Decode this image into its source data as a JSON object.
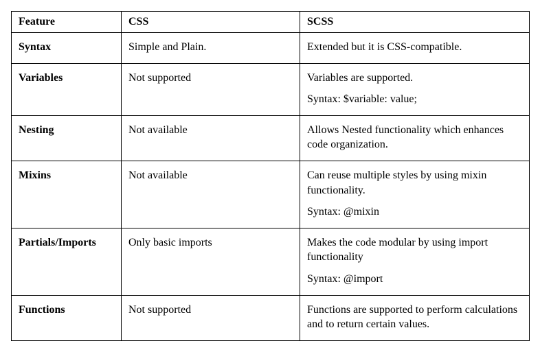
{
  "table": {
    "headers": [
      "Feature",
      "CSS",
      "SCSS"
    ],
    "rows": [
      {
        "feature": "Syntax",
        "css": [
          "Simple and Plain."
        ],
        "scss": [
          "Extended but it is CSS-compatible."
        ]
      },
      {
        "feature": "Variables",
        "css": [
          "Not supported"
        ],
        "scss": [
          "Variables are supported.",
          "Syntax: $variable: value;"
        ]
      },
      {
        "feature": "Nesting",
        "css": [
          "Not available"
        ],
        "scss": [
          "Allows Nested functionality which enhances code organization."
        ]
      },
      {
        "feature": "Mixins",
        "css": [
          "Not available"
        ],
        "scss": [
          "Can reuse multiple styles by using mixin functionality.",
          "Syntax: @mixin"
        ]
      },
      {
        "feature": "Partials/Imports",
        "css": [
          "Only basic imports"
        ],
        "scss": [
          "Makes the code modular by using import functionality",
          "Syntax: @import"
        ]
      },
      {
        "feature": "Functions",
        "css": [
          "Not supported"
        ],
        "scss": [
          "Functions are supported to perform calculations and to return certain values."
        ]
      }
    ]
  }
}
